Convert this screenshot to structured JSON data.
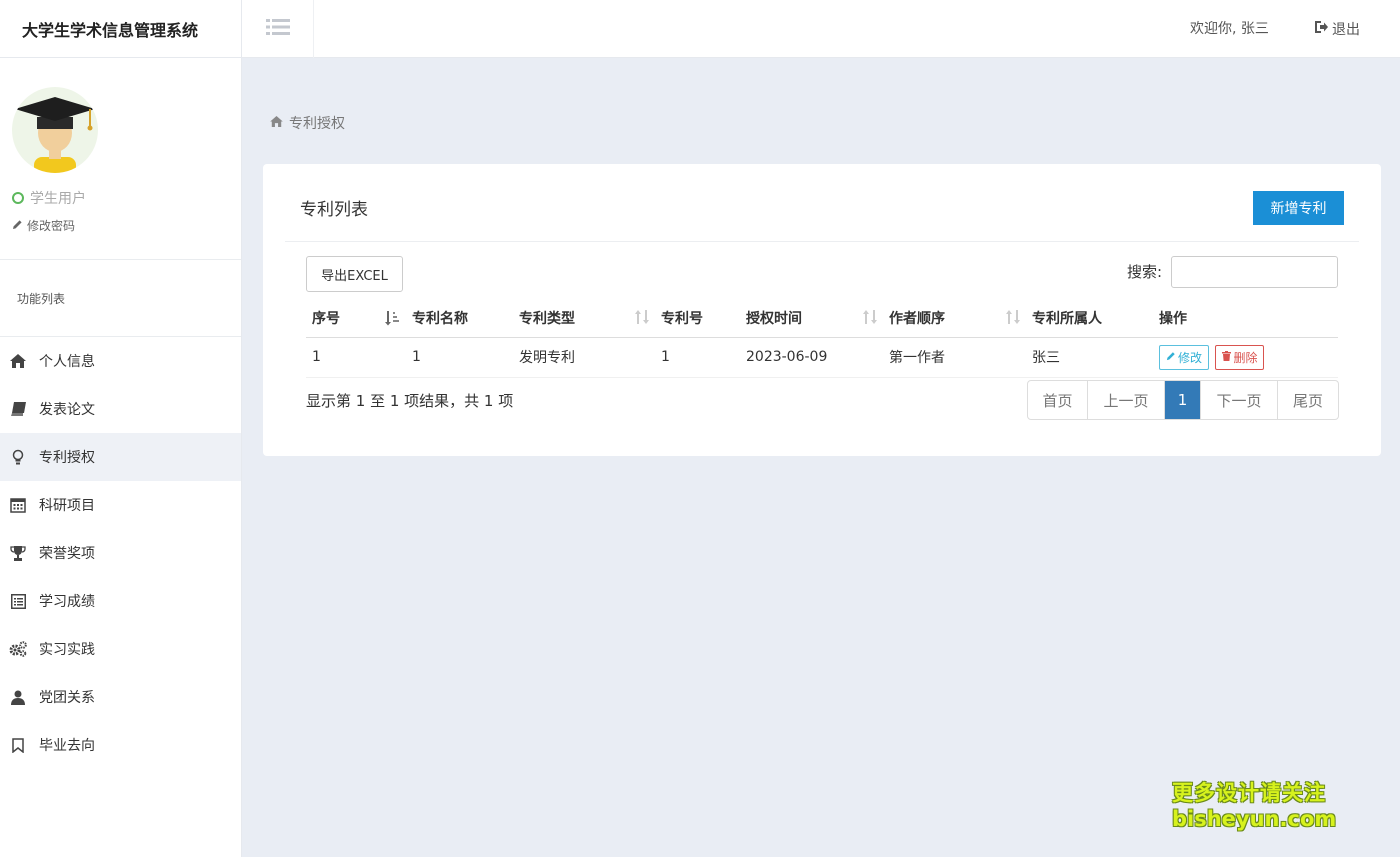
{
  "app": {
    "title": "大学生学术信息管理系统"
  },
  "header": {
    "welcome": "欢迎你, 张三",
    "logout_label": "退出"
  },
  "sidebar": {
    "role": "学生用户",
    "change_password": "修改密码",
    "section_title": "功能列表",
    "items": [
      {
        "label": "个人信息",
        "icon": "home-icon"
      },
      {
        "label": "发表论文",
        "icon": "book-icon"
      },
      {
        "label": "专利授权",
        "icon": "lightbulb-icon",
        "active": true
      },
      {
        "label": "科研项目",
        "icon": "calendar-icon"
      },
      {
        "label": "荣誉奖项",
        "icon": "trophy-icon"
      },
      {
        "label": "学习成绩",
        "icon": "list-alt-icon"
      },
      {
        "label": "实习实践",
        "icon": "gears-icon"
      },
      {
        "label": "党团关系",
        "icon": "user-icon"
      },
      {
        "label": "毕业去向",
        "icon": "bookmark-icon"
      }
    ]
  },
  "breadcrumb": {
    "label": "专利授权"
  },
  "panel": {
    "title": "专利列表",
    "add_label": "新增专利",
    "export_label": "导出EXCEL",
    "search_label": "搜索:",
    "search_value": ""
  },
  "table": {
    "columns": [
      "序号",
      "专利名称",
      "专利类型",
      "专利号",
      "授权时间",
      "作者顺序",
      "专利所属人",
      "操作"
    ],
    "rows": [
      {
        "no": "1",
        "name": "1",
        "type": "发明专利",
        "patent_no": "1",
        "date": "2023-06-09",
        "order": "第一作者",
        "owner": "张三",
        "edit": "修改",
        "delete": "删除"
      }
    ],
    "info": "显示第 1 至 1 项结果，共 1 项"
  },
  "pagination": {
    "first": "首页",
    "prev": "上一页",
    "current": "1",
    "next": "下一页",
    "last": "尾页"
  },
  "watermark": {
    "line1": "更多设计请关注",
    "line2": "bisheyun.com"
  },
  "colors": {
    "primary": "#1b8fd6",
    "page_active": "#337ab7",
    "online": "#5cb85c",
    "danger": "#d9534f",
    "info": "#31b0d5"
  }
}
